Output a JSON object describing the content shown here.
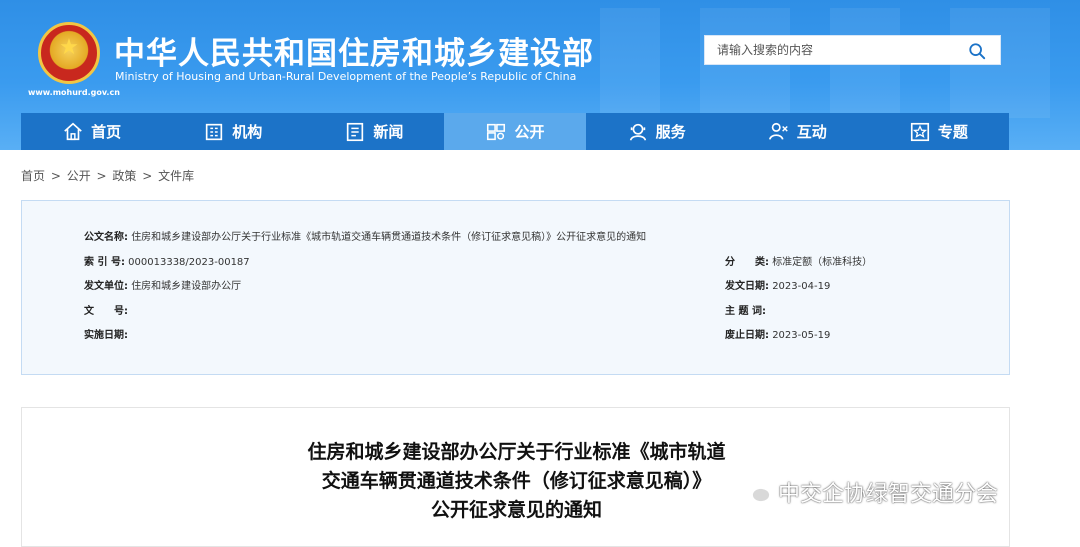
{
  "header": {
    "title_cn": "中华人民共和国住房和城乡建设部",
    "title_en": "Ministry of Housing and Urban-Rural Development of the People’s Republic of China",
    "url": "www.mohurd.gov.cn",
    "search_placeholder": "请输入搜索的内容"
  },
  "nav": [
    {
      "label": "首页",
      "icon": "home-icon"
    },
    {
      "label": "机构",
      "icon": "building-icon"
    },
    {
      "label": "新闻",
      "icon": "news-icon"
    },
    {
      "label": "公开",
      "icon": "open-icon",
      "active": true
    },
    {
      "label": "服务",
      "icon": "service-icon"
    },
    {
      "label": "互动",
      "icon": "interact-icon"
    },
    {
      "label": "专题",
      "icon": "topic-icon"
    }
  ],
  "breadcrumb": [
    "首页",
    "公开",
    "政策",
    "文件库"
  ],
  "meta": {
    "name_label": "公文名称:",
    "name_value": "住房和城乡建设部办公厅关于行业标准《城市轨道交通车辆贯通道技术条件（修订征求意见稿）》公开征求意见的通知",
    "index_label": "索 引 号:",
    "index_value": "000013338/2023-00187",
    "category_label": "分　　类:",
    "category_value": "标准定额（标准科技）",
    "issuer_label": "发文单位:",
    "issuer_value": "住房和城乡建设部办公厅",
    "date_label": "发文日期:",
    "date_value": "2023-04-19",
    "docno_label": "文　　号:",
    "docno_value": "",
    "keyword_label": "主 题 词:",
    "keyword_value": "",
    "effective_label": "实施日期:",
    "effective_value": "",
    "expiry_label": "废止日期:",
    "expiry_value": "2023-05-19"
  },
  "article": {
    "title_lines": [
      "住房和城乡建设部办公厅关于行业标准《城市轨道",
      "交通车辆贯通道技术条件（修订征求意见稿）》",
      "公开征求意见的通知"
    ]
  },
  "watermark": {
    "text": "中交企协绿智交通分会",
    "icon": "wechat-icon"
  }
}
